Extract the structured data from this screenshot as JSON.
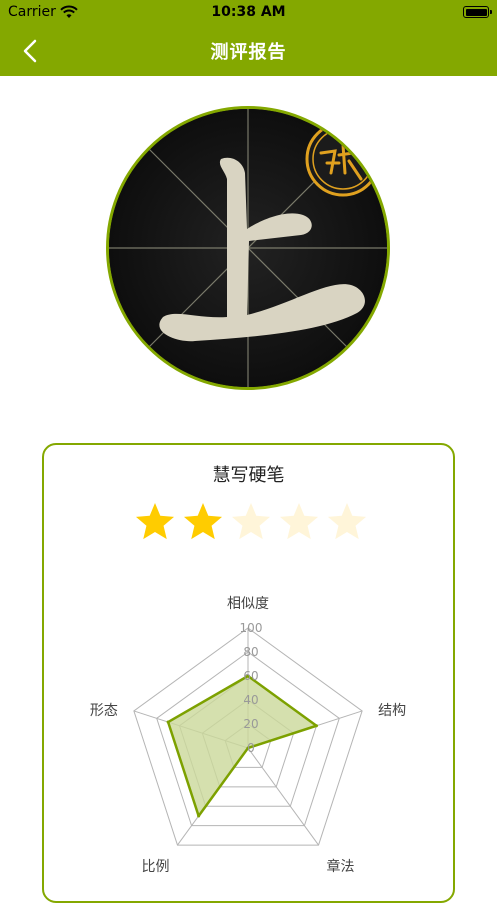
{
  "statusbar": {
    "carrier": "Carrier",
    "time": "10:38 AM"
  },
  "navbar": {
    "title": "测评报告"
  },
  "report": {
    "name": "慧写硬笔",
    "stars_total": 5,
    "stars_filled": 2
  },
  "chart_data": {
    "type": "radar",
    "axes": [
      "相似度",
      "结构",
      "章法",
      "比例",
      "形态"
    ],
    "ticks": [
      "0",
      "20",
      "40",
      "60",
      "80",
      "100"
    ],
    "range": [
      0,
      100
    ],
    "values": [
      60,
      60,
      0,
      70,
      70
    ],
    "colors": {
      "fill": "#cbd89a",
      "line": "#7da100",
      "grid": "#b5b5b5"
    }
  },
  "colors": {
    "accent": "#84a800",
    "star_on": "#ffcc00",
    "star_off": "#fff5d9"
  }
}
